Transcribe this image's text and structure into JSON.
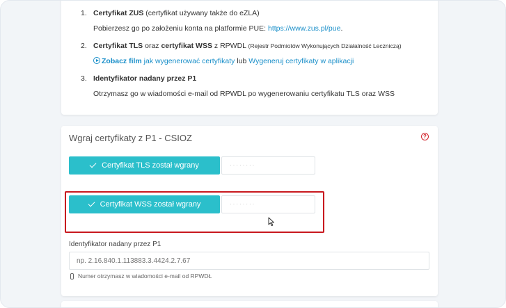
{
  "steps": [
    {
      "num": "1.",
      "title": "Certyfikat ZUS",
      "title_note": " (certyfikat używany także do eZLA)",
      "desc": "Pobierzesz go po założeniu konta na platformie PUE: ",
      "desc_link": "https://www.zus.pl/pue",
      "desc_end": "."
    },
    {
      "num": "2.",
      "title_a": "Certyfikat TLS",
      "mid": " oraz ",
      "title_b": "certyfikat WSS",
      "after": " z RPWDL ",
      "small": "(Rejestr Podmiotów Wykonujących Działalność Leczniczą)",
      "link_film": "Zobacz film",
      "link_gen": " jak wygenerować certyfikaty",
      "or": " lub ",
      "link_app": "Wygeneruj certyfikaty w aplikacji"
    },
    {
      "num": "3.",
      "title": "Identyfikator nadany przez P1",
      "desc": "Otrzymasz go w wiadomości e-mail od RPWDL po wygenerowaniu certyfikatu TLS oraz WSS"
    }
  ],
  "upload": {
    "title": "Wgraj certyfikaty z P1 - CSIOZ",
    "help_icon": "?",
    "tls_button": "Certyfikat TLS został wgrany",
    "tls_password_mask": "········",
    "wss_button": "Certyfikat WSS został wgrany",
    "wss_password_mask": "········",
    "id_label": "Identyfikator nadany przez P1",
    "id_placeholder": "np. 2.16.840.1.113883.3.4424.2.7.67",
    "hint": "Numer otrzymasz w wiadomości e-mail od RPWDŁ"
  },
  "colors": {
    "accent": "#2bbfcb",
    "link": "#1a8fc9",
    "highlight": "#c8181e",
    "background": "#f2f5f8"
  }
}
